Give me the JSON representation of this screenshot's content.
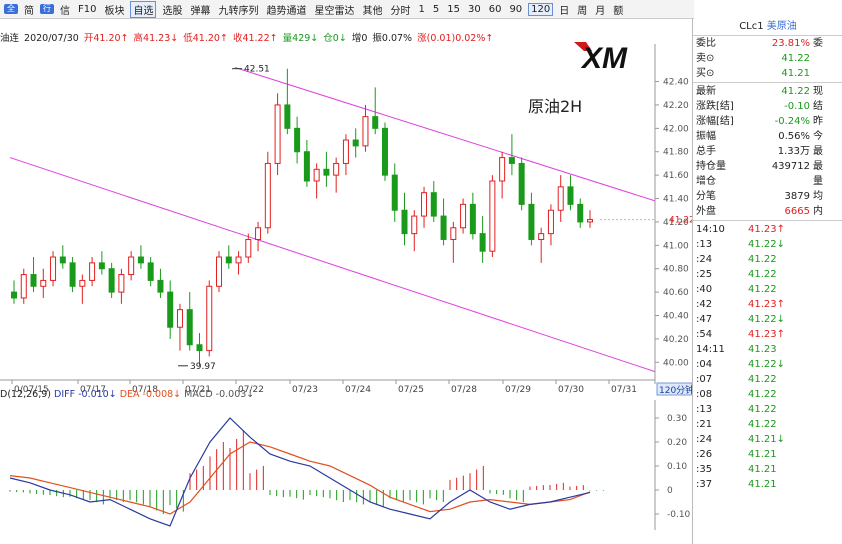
{
  "toolbar": {
    "items": [
      "全",
      "简",
      "行",
      "信",
      "F10",
      "板块",
      "自选",
      "选股",
      "弹幕",
      "九转序列",
      "趋势通道",
      "星空雷达",
      "其他",
      "分时",
      "1",
      "5",
      "15",
      "30",
      "60",
      "90",
      "120",
      "日",
      "周",
      "月",
      "额"
    ]
  },
  "infobar": {
    "name": "油连",
    "date": "2020/07/30",
    "open": "开41.20↑",
    "high": "高41.23↓",
    "low": "低41.20↑",
    "close": "收41.22↑",
    "volume": "量429↓",
    "oi": "仓0↓",
    "oi_inc": "增0",
    "amp": "振0.07%",
    "chg": "涨(0.01)0.02%↑"
  },
  "logo_text": "XM",
  "chart_title": "原油2H",
  "price_axis": {
    "ticks": [
      "42.40",
      "42.20",
      "42.00",
      "41.80",
      "41.60",
      "41.40",
      "41.20",
      "41.00",
      "40.80",
      "40.60",
      "40.40",
      "40.20",
      "40.00"
    ],
    "current_price": "41.22",
    "high_label": "42.51",
    "low_label": "39.97"
  },
  "x_axis": {
    "labels": [
      "0/07/15",
      "07/17",
      "07/18",
      "07/21",
      "07/22",
      "07/23",
      "07/24",
      "07/25",
      "07/28",
      "07/29",
      "07/30",
      "07/31"
    ],
    "period": "120分钟"
  },
  "macd_legend": {
    "params": "D(12,26,9)",
    "diff": "DIFF -0.010↓",
    "dea": "DEA -0.008↓",
    "macd": "MACD -0.003↓"
  },
  "macd_axis": {
    "ticks": [
      "0.30",
      "0.20",
      "0.10",
      "0",
      "-0.10"
    ]
  },
  "right_panel": {
    "symbol": "CLc1",
    "symbol_name": "美原油",
    "rows": [
      {
        "label": "委比",
        "value": "23.81%",
        "extra": "委",
        "color": "up"
      },
      {
        "label": "卖⊙",
        "value": "41.22",
        "extra": "",
        "color": "down"
      },
      {
        "label": "买⊙",
        "value": "41.21",
        "extra": "",
        "color": "down"
      }
    ],
    "rows2": [
      {
        "label": "最新",
        "value": "41.22",
        "extra": "现",
        "color": "down"
      },
      {
        "label": "涨跌[结]",
        "value": "-0.10",
        "extra": "结",
        "color": "down"
      },
      {
        "label": "涨幅[结]",
        "value": "-0.24%",
        "extra": "昨",
        "color": "down"
      },
      {
        "label": "振幅",
        "value": "0.56%",
        "extra": "今",
        "color": "plain"
      },
      {
        "label": "总手",
        "value": "1.33万",
        "extra": "最",
        "color": "plain"
      },
      {
        "label": "持仓量",
        "value": "439712",
        "extra": "最",
        "color": "plain"
      },
      {
        "label": "增仓",
        "value": "",
        "extra": "量",
        "color": "plain"
      },
      {
        "label": "分笔",
        "value": "3879",
        "extra": "均",
        "color": "plain"
      },
      {
        "label": "外盘",
        "value": "6665",
        "extra": "内",
        "color": "up"
      }
    ],
    "ticks": [
      {
        "time": "14:10",
        "price": "41.23↑"
      },
      {
        "time": ":13",
        "price": "41.22↓"
      },
      {
        "time": ":24",
        "price": "41.22"
      },
      {
        "time": ":25",
        "price": "41.22"
      },
      {
        "time": ":40",
        "price": "41.22"
      },
      {
        "time": ":42",
        "price": "41.23↑"
      },
      {
        "time": ":47",
        "price": "41.22↓"
      },
      {
        "time": ":54",
        "price": "41.23↑"
      },
      {
        "time": "14:11",
        "price": "41.23"
      },
      {
        "time": ":04",
        "price": "41.22↓"
      },
      {
        "time": ":07",
        "price": "41.22"
      },
      {
        "time": ":08",
        "price": "41.22"
      },
      {
        "time": ":13",
        "price": "41.22"
      },
      {
        "time": ":21",
        "price": "41.22"
      },
      {
        "time": ":24",
        "price": "41.21↓"
      },
      {
        "time": ":26",
        "price": "41.21"
      },
      {
        "time": ":35",
        "price": "41.21"
      },
      {
        "time": ":37",
        "price": "41.21"
      }
    ]
  },
  "colors": {
    "up": "#e02020",
    "down": "#1a9a1a",
    "channel": "#e040e0",
    "diff": "#2a3aa0",
    "dea": "#e05020"
  },
  "chart_data": {
    "type": "candlestick",
    "y_range": [
      40.0,
      42.4
    ],
    "candles": [
      [
        40.6,
        40.7,
        40.5,
        40.55
      ],
      [
        40.55,
        40.8,
        40.5,
        40.75
      ],
      [
        40.75,
        40.9,
        40.6,
        40.65
      ],
      [
        40.65,
        40.8,
        40.55,
        40.7
      ],
      [
        40.7,
        40.95,
        40.65,
        40.9
      ],
      [
        40.9,
        41.0,
        40.8,
        40.85
      ],
      [
        40.85,
        40.9,
        40.6,
        40.65
      ],
      [
        40.65,
        40.75,
        40.5,
        40.7
      ],
      [
        40.7,
        40.9,
        40.65,
        40.85
      ],
      [
        40.85,
        40.95,
        40.75,
        40.8
      ],
      [
        40.8,
        40.85,
        40.55,
        40.6
      ],
      [
        40.6,
        40.8,
        40.5,
        40.75
      ],
      [
        40.75,
        40.95,
        40.7,
        40.9
      ],
      [
        40.9,
        41.0,
        40.8,
        40.85
      ],
      [
        40.85,
        40.9,
        40.65,
        40.7
      ],
      [
        40.7,
        40.8,
        40.55,
        40.6
      ],
      [
        40.6,
        40.7,
        40.2,
        40.3
      ],
      [
        40.3,
        40.5,
        40.1,
        40.45
      ],
      [
        40.45,
        40.6,
        40.1,
        40.15
      ],
      [
        40.15,
        40.25,
        39.97,
        40.1
      ],
      [
        40.1,
        40.7,
        40.05,
        40.65
      ],
      [
        40.65,
        40.95,
        40.6,
        40.9
      ],
      [
        40.9,
        41.0,
        40.8,
        40.85
      ],
      [
        40.85,
        40.95,
        40.75,
        40.9
      ],
      [
        40.9,
        41.1,
        40.85,
        41.05
      ],
      [
        41.05,
        41.2,
        40.95,
        41.15
      ],
      [
        41.15,
        41.8,
        41.1,
        41.7
      ],
      [
        41.7,
        42.3,
        41.6,
        42.2
      ],
      [
        42.2,
        42.51,
        41.95,
        42.0
      ],
      [
        42.0,
        42.1,
        41.7,
        41.8
      ],
      [
        41.8,
        41.9,
        41.5,
        41.55
      ],
      [
        41.55,
        41.7,
        41.4,
        41.65
      ],
      [
        41.65,
        41.8,
        41.5,
        41.6
      ],
      [
        41.6,
        41.75,
        41.45,
        41.7
      ],
      [
        41.7,
        41.95,
        41.6,
        41.9
      ],
      [
        41.9,
        42.0,
        41.75,
        41.85
      ],
      [
        41.85,
        42.2,
        41.8,
        42.1
      ],
      [
        42.1,
        42.35,
        41.95,
        42.0
      ],
      [
        42.0,
        42.05,
        41.55,
        41.6
      ],
      [
        41.6,
        41.7,
        41.2,
        41.3
      ],
      [
        41.3,
        41.45,
        41.0,
        41.1
      ],
      [
        41.1,
        41.3,
        40.95,
        41.25
      ],
      [
        41.25,
        41.5,
        41.15,
        41.45
      ],
      [
        41.45,
        41.55,
        41.2,
        41.25
      ],
      [
        41.25,
        41.4,
        41.0,
        41.05
      ],
      [
        41.05,
        41.2,
        40.85,
        41.15
      ],
      [
        41.15,
        41.4,
        41.1,
        41.35
      ],
      [
        41.35,
        41.45,
        41.05,
        41.1
      ],
      [
        41.1,
        41.25,
        40.85,
        40.95
      ],
      [
        40.95,
        41.6,
        40.9,
        41.55
      ],
      [
        41.55,
        41.8,
        41.4,
        41.75
      ],
      [
        41.75,
        41.95,
        41.6,
        41.7
      ],
      [
        41.7,
        41.75,
        41.3,
        41.35
      ],
      [
        41.35,
        41.45,
        41.0,
        41.05
      ],
      [
        41.05,
        41.15,
        40.85,
        41.1
      ],
      [
        41.1,
        41.35,
        41.0,
        41.3
      ],
      [
        41.3,
        41.6,
        41.2,
        41.5
      ],
      [
        41.5,
        41.6,
        41.3,
        41.35
      ],
      [
        41.35,
        41.4,
        41.15,
        41.2
      ],
      [
        41.2,
        41.3,
        41.15,
        41.22
      ]
    ],
    "macd": {
      "diff": [
        0.05,
        0.03,
        0.0,
        -0.02,
        -0.05,
        -0.04,
        -0.08,
        -0.12,
        -0.15,
        0.05,
        0.2,
        0.3,
        0.22,
        0.15,
        0.12,
        0.1,
        0.05,
        0.0,
        -0.05,
        -0.08,
        -0.1,
        -0.12,
        -0.05,
        0.0,
        -0.05,
        -0.08,
        -0.06,
        -0.05,
        -0.03,
        -0.01
      ],
      "dea": [
        0.06,
        0.05,
        0.03,
        0.01,
        -0.01,
        -0.03,
        -0.05,
        -0.07,
        -0.1,
        -0.05,
        0.05,
        0.15,
        0.2,
        0.18,
        0.15,
        0.12,
        0.1,
        0.06,
        0.02,
        -0.03,
        -0.06,
        -0.09,
        -0.08,
        -0.05,
        -0.04,
        -0.05,
        -0.06,
        -0.05,
        -0.04,
        -0.008
      ],
      "bars": [
        -0.01,
        -0.02,
        -0.03,
        -0.04,
        -0.06,
        -0.05,
        -0.06,
        -0.1,
        -0.09,
        0.1,
        0.2,
        0.25,
        0.1,
        -0.03,
        -0.04,
        -0.03,
        -0.05,
        -0.06,
        -0.07,
        -0.05,
        -0.06,
        -0.05,
        0.06,
        0.1,
        -0.02,
        -0.05,
        0.02,
        0.03,
        0.02,
        -0.003
      ]
    }
  }
}
